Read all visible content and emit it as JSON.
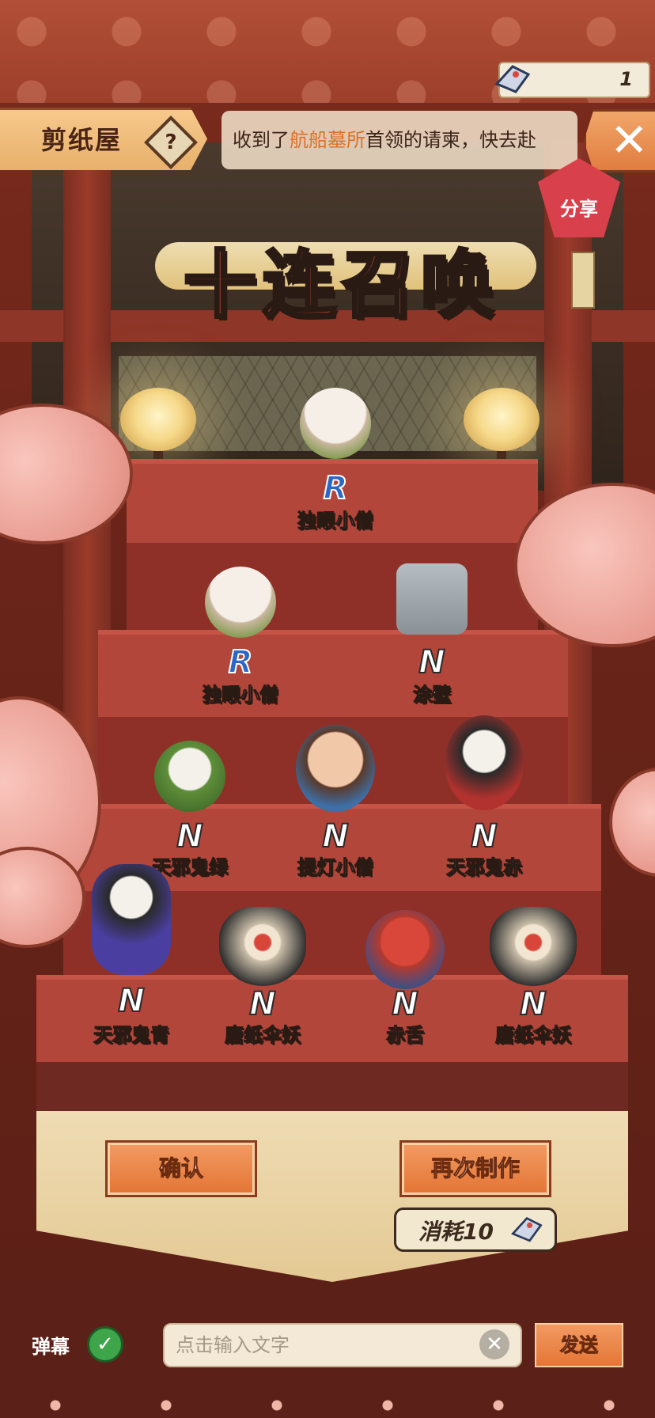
{
  "header": {
    "title": "剪纸屋",
    "help_icon_label": "?",
    "notice_prefix": "收到了",
    "notice_highlight": "航船墓所",
    "notice_suffix": "首领的请柬，快去赴",
    "close_label": "✕",
    "ticket_count": "1",
    "share_label": "分享"
  },
  "main": {
    "title": "十连召唤",
    "summons": [
      {
        "name": "独眼小僧",
        "rarity": "R"
      },
      {
        "name": "独眼小僧",
        "rarity": "R"
      },
      {
        "name": "涂壁",
        "rarity": "N"
      },
      {
        "name": "天邪鬼绿",
        "rarity": "N"
      },
      {
        "name": "提灯小僧",
        "rarity": "N"
      },
      {
        "name": "天邪鬼赤",
        "rarity": "N"
      },
      {
        "name": "天邪鬼青",
        "rarity": "N"
      },
      {
        "name": "唐纸伞妖",
        "rarity": "N"
      },
      {
        "name": "赤舌",
        "rarity": "N"
      },
      {
        "name": "唐纸伞妖",
        "rarity": "N"
      }
    ],
    "confirm_label": "确认",
    "again_label": "再次制作",
    "cost_label": "消耗10"
  },
  "bottom": {
    "danmaku_label": "弹幕",
    "input_placeholder": "点击输入文字",
    "clear_label": "✕",
    "send_label": "发送"
  },
  "colors": {
    "accent_orange": "#e47636",
    "rarity_r": "#2c67c6",
    "title_orange": "#f0633d"
  }
}
